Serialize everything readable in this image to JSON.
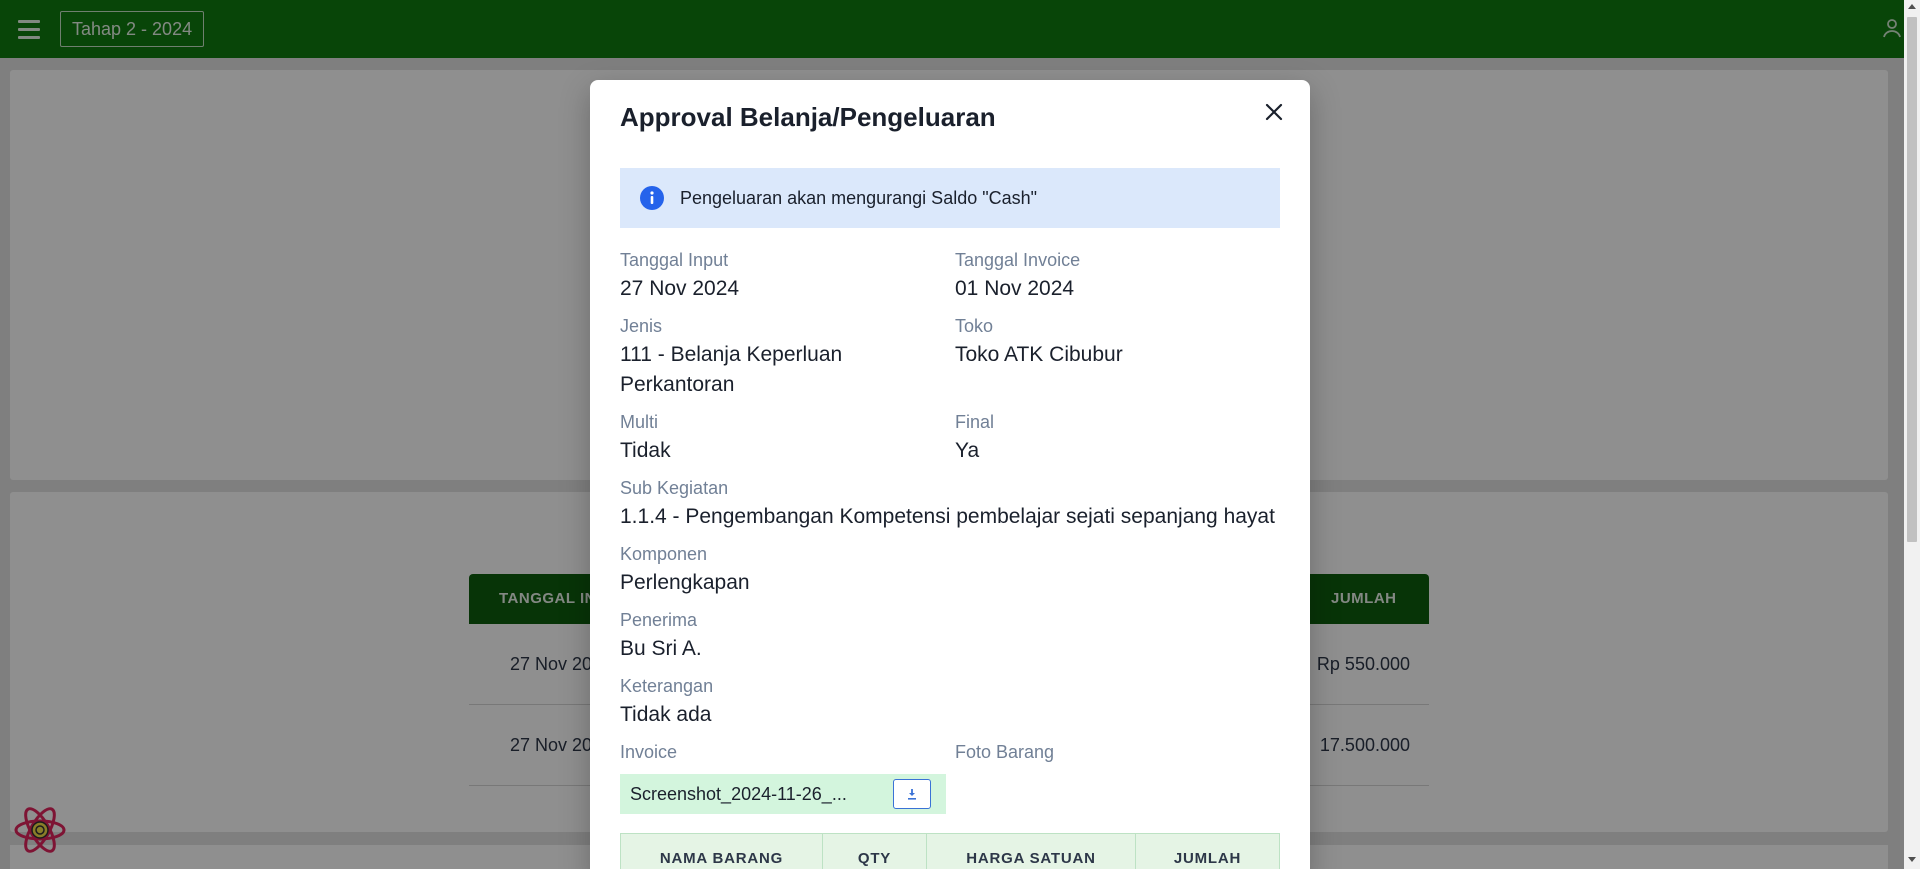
{
  "topbar": {
    "stage_label": "Tahap 2 - 2024",
    "menu_icon": "hamburger-menu-icon",
    "user_icon": "user-icon",
    "color": "#0f7b0f"
  },
  "background_table": {
    "headers": [
      "TANGGAL IN",
      "JUMLAH"
    ],
    "rows": [
      {
        "date": "27 Nov 20",
        "amount": "Rp 550.000"
      },
      {
        "date": "27 Nov 20",
        "amount": "17.500.000"
      }
    ]
  },
  "modal": {
    "title": "Approval Belanja/Pengeluaran",
    "close_icon": "close-icon",
    "alert": {
      "icon": "info-icon",
      "text": "Pengeluaran akan mengurangi Saldo \"Cash\""
    },
    "fields": {
      "tanggal_input": {
        "label": "Tanggal Input",
        "value": "27 Nov 2024"
      },
      "tanggal_invoice": {
        "label": "Tanggal Invoice",
        "value": "01 Nov 2024"
      },
      "jenis": {
        "label": "Jenis",
        "value_line1": "111 - Belanja Keperluan",
        "value_line2": "Perkantoran"
      },
      "toko": {
        "label": "Toko",
        "value": "Toko ATK Cibubur"
      },
      "multi": {
        "label": "Multi",
        "value": "Tidak"
      },
      "final": {
        "label": "Final",
        "value": "Ya"
      },
      "sub_kegiatan": {
        "label": "Sub Kegiatan",
        "value": "1.1.4 - Pengembangan Kompetensi pembelajar sejati sepanjang hayat"
      },
      "komponen": {
        "label": "Komponen",
        "value": "Perlengkapan"
      },
      "penerima": {
        "label": "Penerima",
        "value": "Bu Sri A."
      },
      "keterangan": {
        "label": "Keterangan",
        "value": "Tidak ada"
      },
      "invoice": {
        "label": "Invoice",
        "file_name": "Screenshot_2024-11-26_..."
      },
      "foto_barang": {
        "label": "Foto Barang"
      }
    },
    "items_table": {
      "headers": [
        "NAMA BARANG",
        "QTY",
        "HARGA SATUAN",
        "JUMLAH"
      ]
    }
  },
  "colors": {
    "alert_bg": "#dbe8fb",
    "info_icon": "#2563eb",
    "invoice_bg": "#d3f5dd",
    "table_head_bg": "#e5f4e5"
  }
}
